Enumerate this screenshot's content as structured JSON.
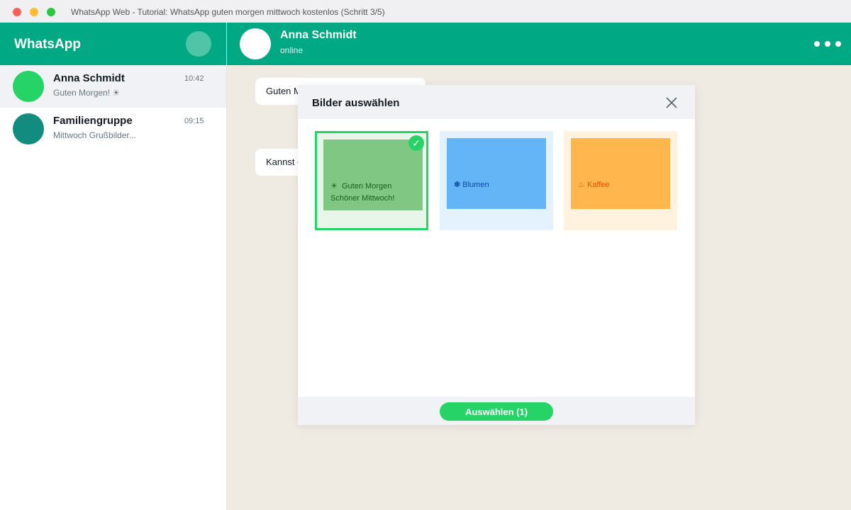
{
  "window": {
    "title": "WhatsApp Web - Tutorial: WhatsApp guten morgen mittwoch kostenlos (Schritt 3/5)"
  },
  "sidebar": {
    "app_name": "WhatsApp",
    "chats": [
      {
        "name": "Anna Schmidt",
        "time": "10:42",
        "preview": "Guten Morgen! ☀",
        "avatar_color": "#25d366",
        "active": true
      },
      {
        "name": "Familiengruppe",
        "time": "09:15",
        "preview": "Mittwoch Grußbilder...",
        "avatar_color": "#128c7e",
        "active": false
      }
    ]
  },
  "chat": {
    "contact_name": "Anna Schmidt",
    "contact_status": "online",
    "messages": [
      {
        "text": "Guten M"
      },
      {
        "text": "Kannst d"
      }
    ]
  },
  "modal": {
    "title": "Bilder auswählen",
    "images": [
      {
        "icon": "☀",
        "line1": "Guten Morgen",
        "line2": "Schöner Mittwoch!",
        "selected": true
      },
      {
        "icon": "✽",
        "label": "Blumen",
        "selected": false
      },
      {
        "icon": "♨",
        "label": "Kaffee",
        "selected": false
      }
    ],
    "checkmark": "✓",
    "select_button": "Auswählen (1)"
  },
  "colors": {
    "brand": "#00a884",
    "accent": "#25d366",
    "chat_background": "#efeae2"
  }
}
